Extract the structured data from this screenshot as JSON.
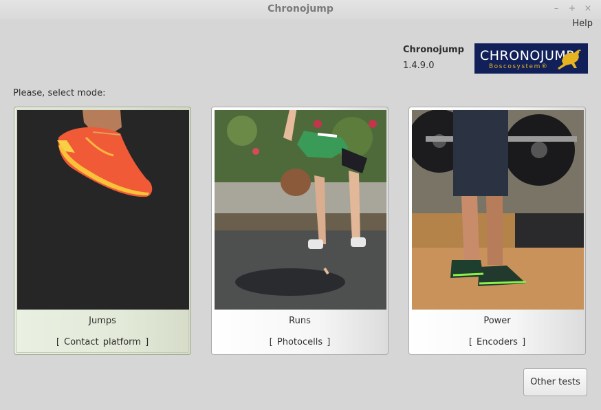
{
  "window": {
    "title": "Chronojump",
    "controls": {
      "minimize": "–",
      "maximize": "+",
      "close": "×"
    }
  },
  "menu": {
    "help": "Help"
  },
  "about": {
    "app_name": "Chronojump",
    "version": "1.4.9.0",
    "logo_text": "CHRONOJUMP",
    "logo_subtext": "Boscosystem®"
  },
  "prompt": "Please, select mode:",
  "modes": [
    {
      "title": "Jumps",
      "subtitle": "[  Contact platform  ]",
      "selected": true,
      "image": "shoe-photo"
    },
    {
      "title": "Runs",
      "subtitle": "[  Photocells  ]",
      "selected": false,
      "image": "sprinter-photo"
    },
    {
      "title": "Power",
      "subtitle": "[  Encoders  ]",
      "selected": false,
      "image": "barbell-photo"
    }
  ],
  "buttons": {
    "other_tests": "Other tests"
  },
  "colors": {
    "logo_bg": "#12205a",
    "logo_accent": "#e6b420",
    "window_bg": "#d6d6d6"
  }
}
